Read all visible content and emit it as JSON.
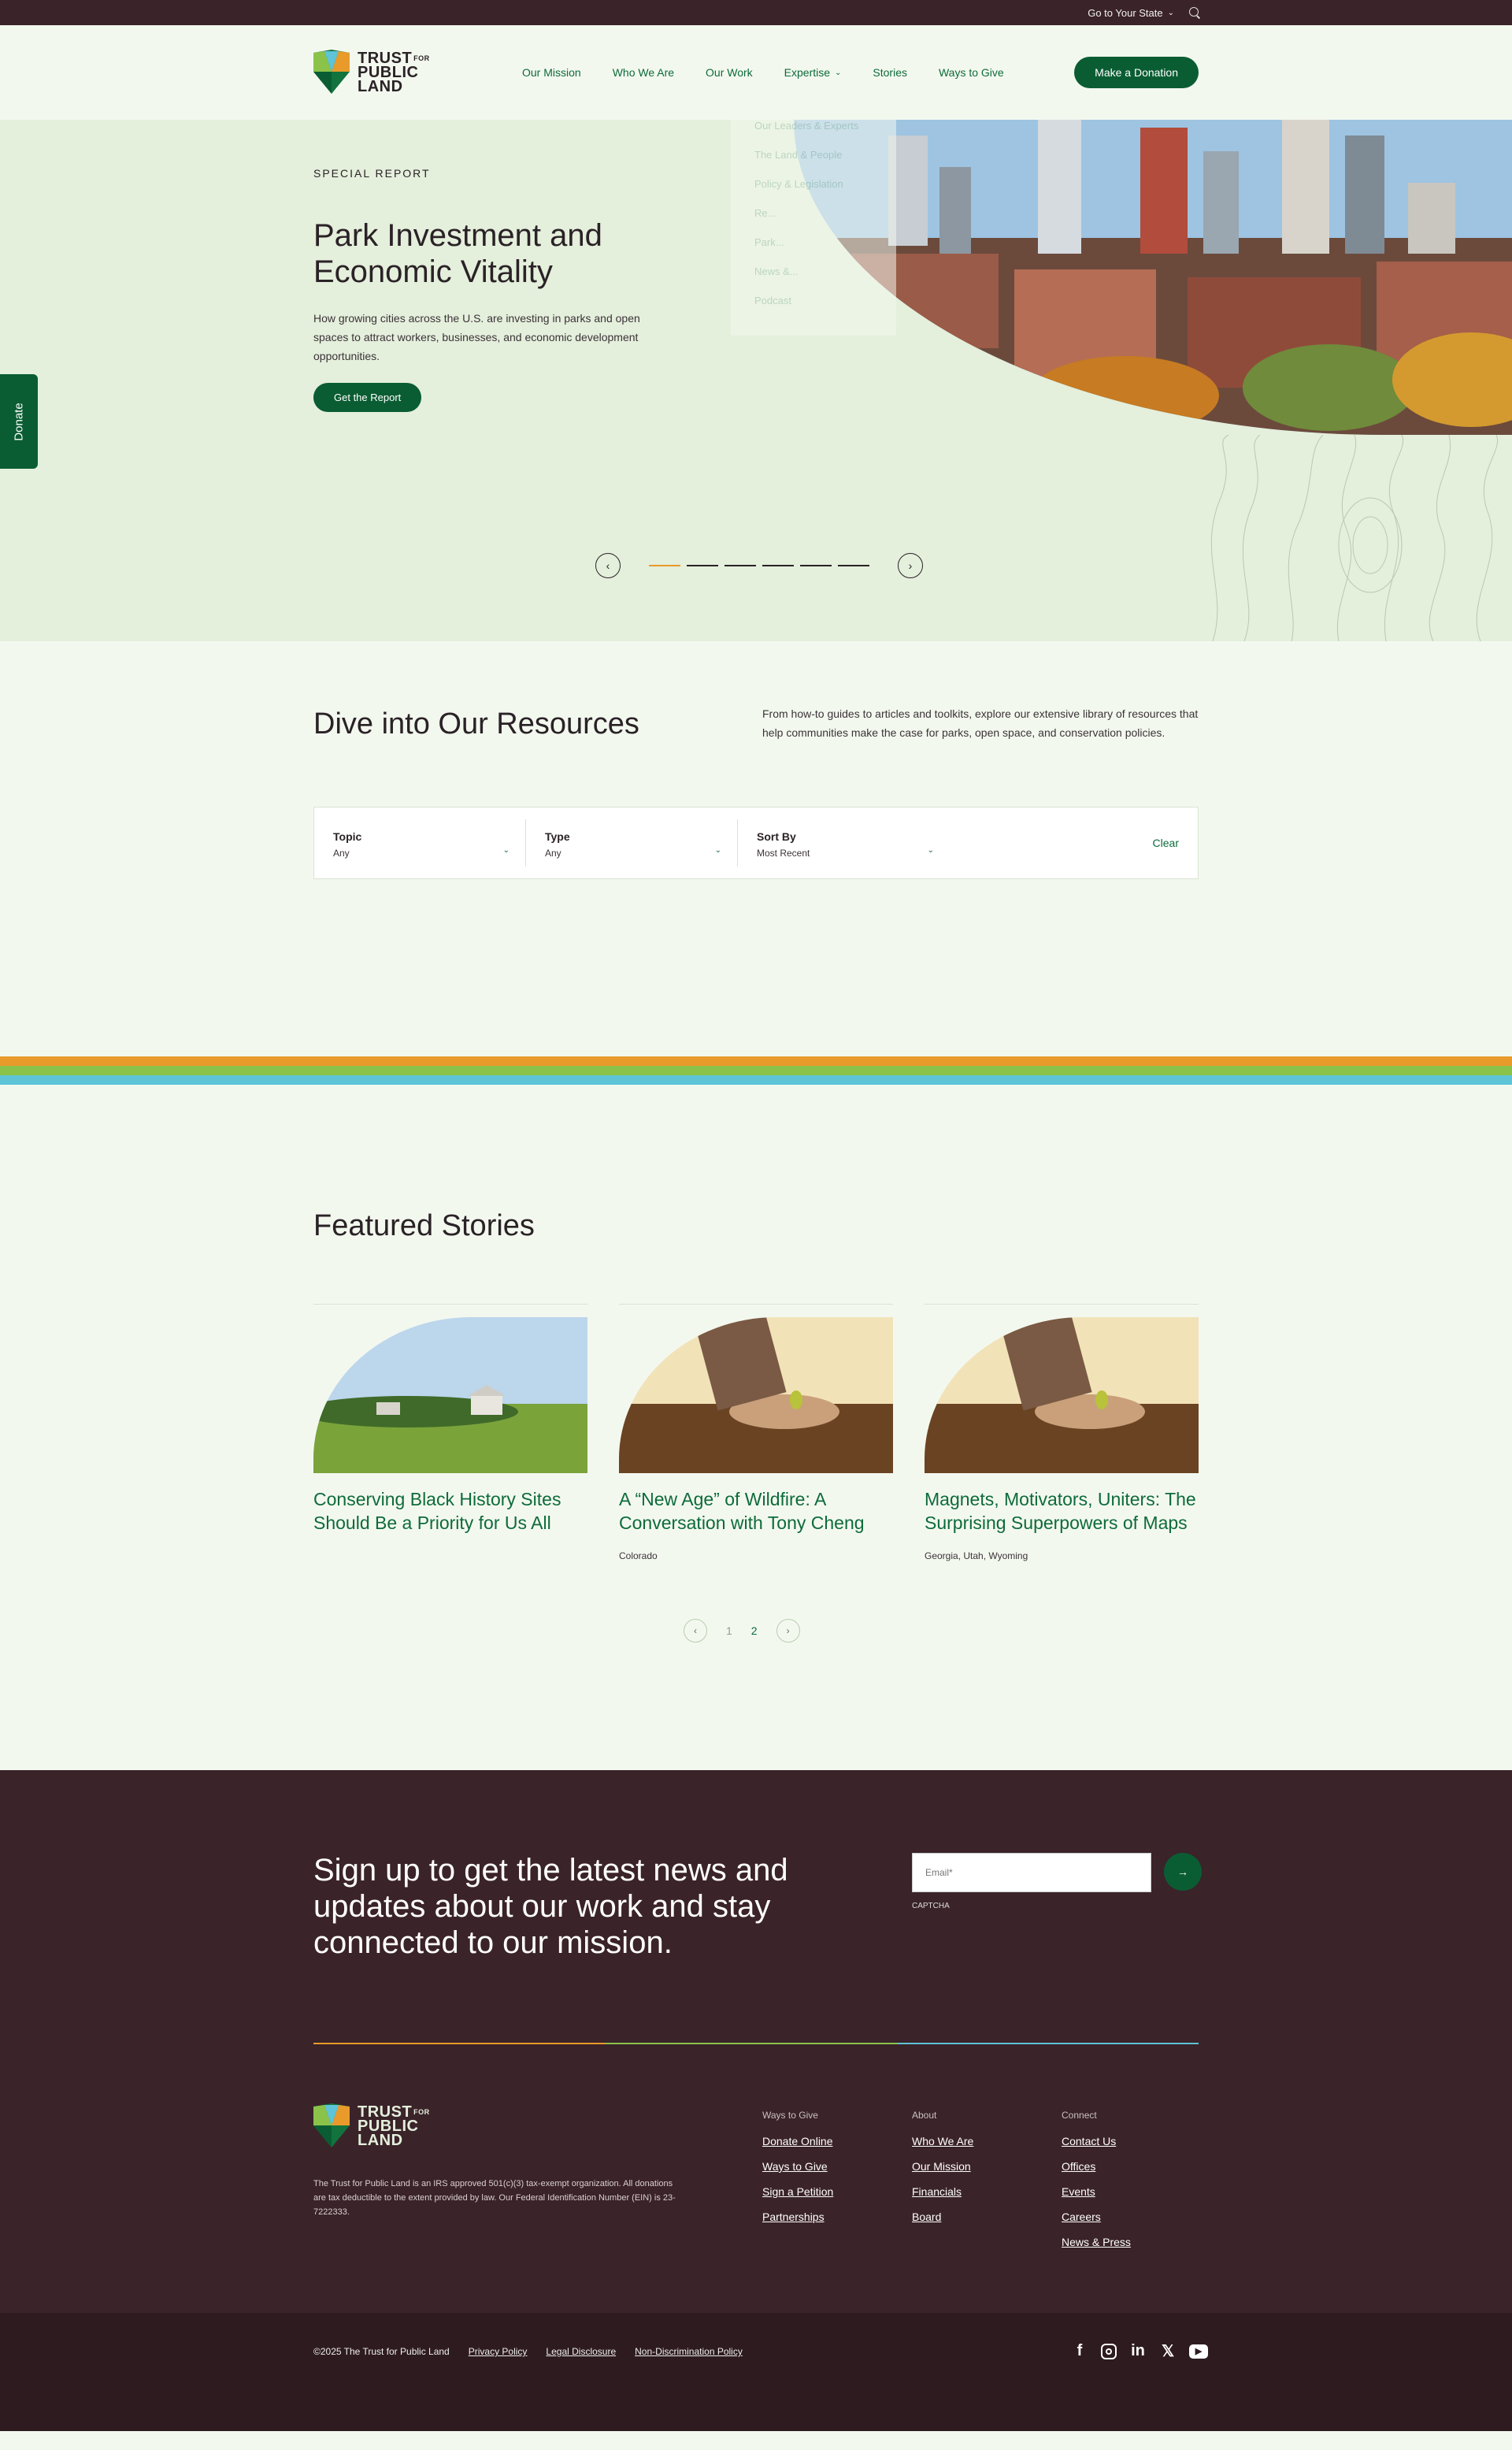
{
  "utility": {
    "state_label": "Go to Your State"
  },
  "header": {
    "logo": {
      "line1": "TRUST",
      "for": "FOR",
      "line2": "PUBLIC",
      "line3": "LAND"
    },
    "nav": [
      "Our Mission",
      "Who We Are",
      "Our Work",
      "Expertise",
      "Stories",
      "Ways to Give"
    ],
    "donate": "Make a Donation"
  },
  "expertise_menu": [
    "Our Leaders & Experts",
    "The Land & People",
    "Policy & Legislation",
    "Re...",
    "Park...",
    "News &...",
    "Podcast"
  ],
  "hero": {
    "eyebrow": "SPECIAL REPORT",
    "title": "Park Investment and Economic Vitality",
    "body": "How growing cities across the U.S. are investing in parks and open spaces to attract workers, businesses, and economic development opportunities.",
    "cta": "Get the Report",
    "side_donate": "Donate"
  },
  "resources": {
    "title": "Dive into Our Resources",
    "body": "From how-to guides to articles and toolkits, explore our extensive library of resources that help communities make the case for parks, open space, and conservation policies.",
    "filters": [
      {
        "label": "Topic",
        "value": "Any"
      },
      {
        "label": "Type",
        "value": "Any"
      },
      {
        "label": "Sort By",
        "value": "Most Recent"
      }
    ],
    "clear": "Clear"
  },
  "rainbow_colors": [
    "#e89b2b",
    "#8bc34a",
    "#5ec4d8"
  ],
  "featured": {
    "title": "Featured Stories",
    "stories": [
      {
        "title": "Conserving Black History Sites Should Be a Priority for Us All",
        "location": ""
      },
      {
        "title": "A “New Age” of Wildfire: A Conversation with Tony Cheng",
        "location": "Colorado"
      },
      {
        "title": "Magnets, Motivators, Uniters: The Surprising Superpowers of Maps",
        "location": "Georgia, Utah, Wyoming"
      }
    ],
    "pages": [
      "1",
      "2"
    ]
  },
  "newsletter": {
    "heading": "Sign up to get the latest news and updates about our work and stay connected to our mission.",
    "email_placeholder": "Email*",
    "captcha": "CAPTCHA"
  },
  "footer": {
    "legal": "The Trust for Public Land is an IRS approved 501(c)(3) tax-exempt organization. All donations are tax deductible to the extent provided by law. Our Federal Identification Number (EIN) is 23-7222333.",
    "columns": [
      {
        "heading": "Ways to Give",
        "links": [
          "Donate Online",
          "Ways to Give",
          "Sign a Petition",
          "Partnerships"
        ]
      },
      {
        "heading": "About",
        "links": [
          "Who We Are",
          "Our Mission",
          "Financials",
          "Board"
        ]
      },
      {
        "heading": "Connect",
        "links": [
          "Contact Us",
          "Offices",
          "Events",
          "Careers",
          "News & Press"
        ]
      }
    ],
    "copyright": "©2025 The Trust for Public Land",
    "legal_links": [
      "Privacy Policy",
      "Legal Disclosure",
      "Non-Discrimination Policy"
    ],
    "social": [
      "facebook-icon",
      "instagram-icon",
      "linkedin-icon",
      "x-icon",
      "youtube-icon"
    ]
  }
}
